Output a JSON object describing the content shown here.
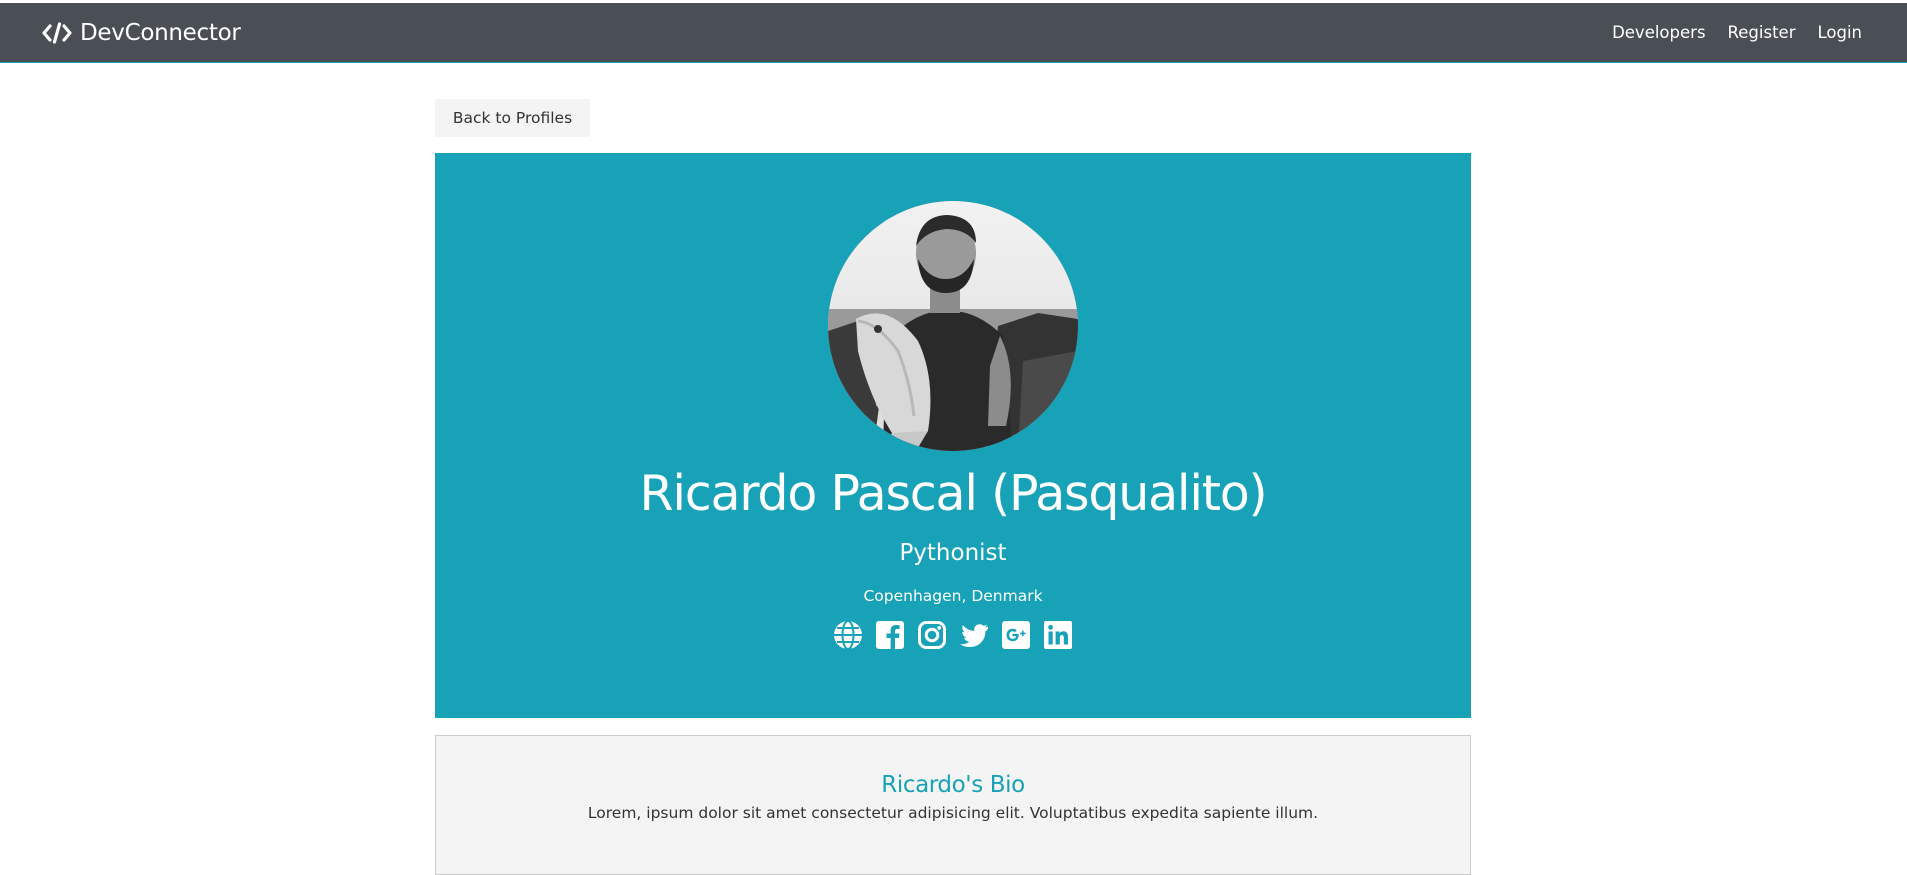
{
  "navbar": {
    "brand_text": "DevConnector",
    "brand_icon": "code-icon",
    "links": [
      {
        "label": "Developers"
      },
      {
        "label": "Register"
      },
      {
        "label": "Login"
      }
    ]
  },
  "back_button_label": "Back to Profiles",
  "profile": {
    "name": "Ricardo Pascal (Pasqualito)",
    "status": "Pythonist",
    "location": "Copenhagen, Denmark",
    "social_icons": [
      "globe-icon",
      "facebook-icon",
      "instagram-icon",
      "twitter-icon",
      "google-plus-icon",
      "linkedin-icon"
    ]
  },
  "bio": {
    "heading": "Ricardo's Bio",
    "text": "Lorem, ipsum dolor sit amet consectetur adipisicing elit. Voluptatibus expedita sapiente illum."
  },
  "colors": {
    "navbar_bg": "#4a4f55",
    "primary": "#17a2b8",
    "light": "#f4f4f4",
    "dark_text": "#333333"
  }
}
